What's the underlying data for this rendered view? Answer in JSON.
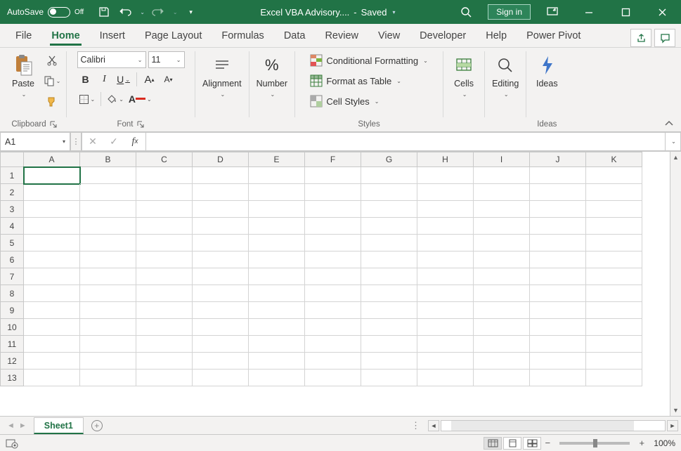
{
  "title": {
    "autosave_label": "AutoSave",
    "autosave_state": "Off",
    "filename": "Excel VBA Advisory....",
    "save_state": "Saved",
    "signin": "Sign in"
  },
  "tabs": {
    "items": [
      "File",
      "Home",
      "Insert",
      "Page Layout",
      "Formulas",
      "Data",
      "Review",
      "View",
      "Developer",
      "Help",
      "Power Pivot"
    ],
    "active_index": 1
  },
  "ribbon": {
    "clipboard": {
      "paste": "Paste",
      "label": "Clipboard"
    },
    "font": {
      "name": "Calibri",
      "size": "11",
      "label": "Font"
    },
    "alignment": {
      "label": "Alignment",
      "btn": "Alignment"
    },
    "number": {
      "label": "Number",
      "btn": "Number"
    },
    "styles": {
      "cond": "Conditional Formatting",
      "table": "Format as Table",
      "cell": "Cell Styles",
      "label": "Styles"
    },
    "cells": {
      "btn": "Cells",
      "label": "Cells"
    },
    "editing": {
      "btn": "Editing",
      "label": "Editing"
    },
    "ideas": {
      "btn": "Ideas",
      "label": "Ideas"
    }
  },
  "formula": {
    "namebox": "A1",
    "value": ""
  },
  "grid": {
    "columns": [
      "A",
      "B",
      "C",
      "D",
      "E",
      "F",
      "G",
      "H",
      "I",
      "J",
      "K"
    ],
    "rows": [
      "1",
      "2",
      "3",
      "4",
      "5",
      "6",
      "7",
      "8",
      "9",
      "10",
      "11",
      "12",
      "13"
    ],
    "selected": "A1"
  },
  "sheets": {
    "items": [
      "Sheet1"
    ],
    "active": 0
  },
  "status": {
    "zoom": "100%"
  }
}
